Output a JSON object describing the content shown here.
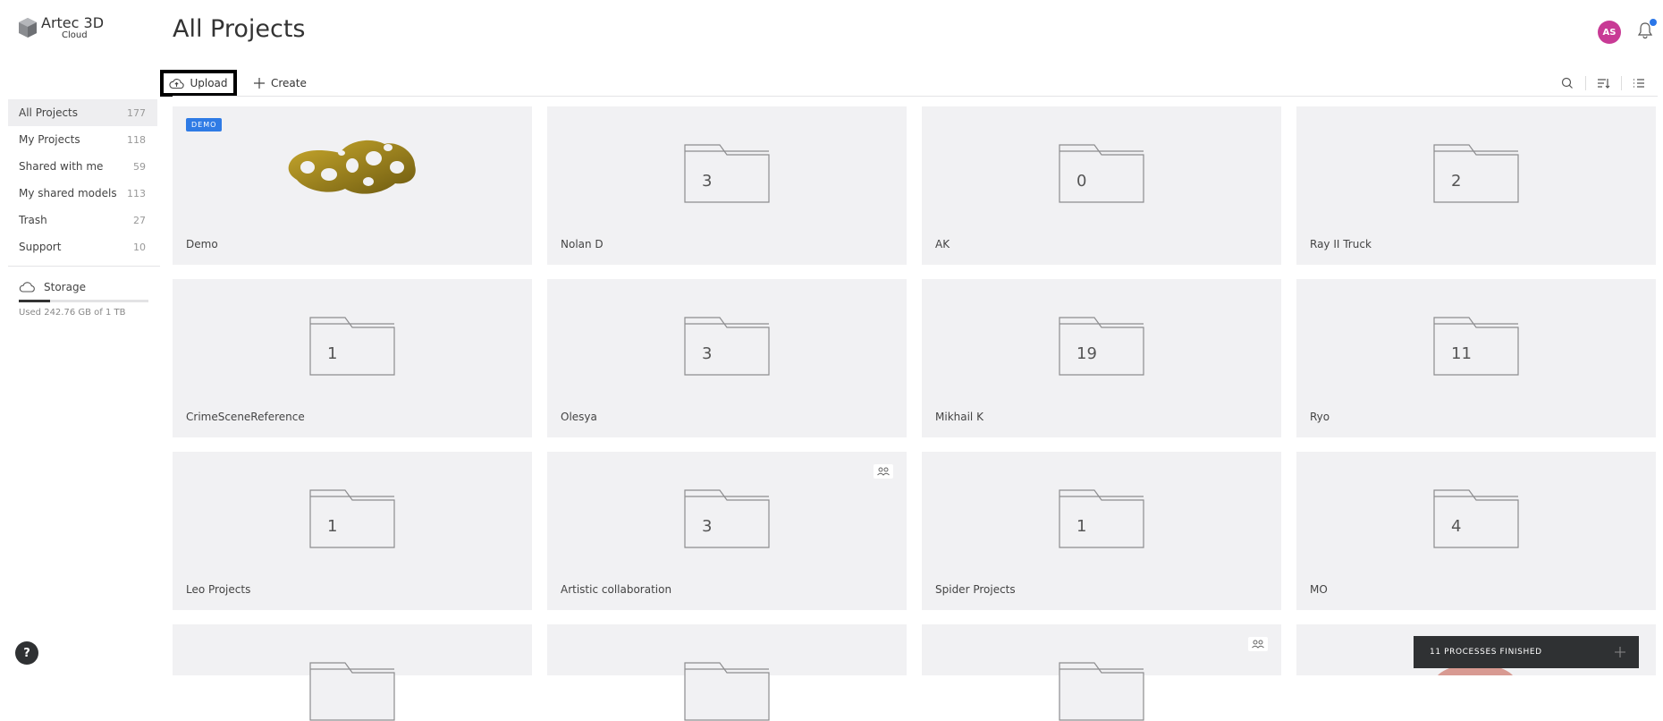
{
  "brand": {
    "name": "Artec 3D",
    "sub": "Cloud"
  },
  "page_title": "All Projects",
  "user": {
    "initials": "AS"
  },
  "toolbar": {
    "upload_label": "Upload",
    "create_label": "Create"
  },
  "sidebar": {
    "items": [
      {
        "label": "All Projects",
        "count": "177"
      },
      {
        "label": "My Projects",
        "count": "118"
      },
      {
        "label": "Shared with me",
        "count": "59"
      },
      {
        "label": "My shared models",
        "count": "113"
      },
      {
        "label": "Trash",
        "count": "27"
      },
      {
        "label": "Support",
        "count": "10"
      }
    ],
    "storage": {
      "label": "Storage",
      "used_text": "Used 242.76 GB of 1 TB",
      "used_fraction": 0.24
    }
  },
  "projects": [
    {
      "name": "Demo",
      "badge": "DEMO"
    },
    {
      "name": "Nolan D",
      "count": "3"
    },
    {
      "name": "AK",
      "count": "0"
    },
    {
      "name": "Ray II Truck",
      "count": "2"
    },
    {
      "name": "CrimeSceneReference",
      "count": "1"
    },
    {
      "name": "Olesya",
      "count": "3"
    },
    {
      "name": "Mikhail K",
      "count": "19"
    },
    {
      "name": "Ryo",
      "count": "11"
    },
    {
      "name": "Leo Projects",
      "count": "1"
    },
    {
      "name": "Artistic collaboration",
      "count": "3"
    },
    {
      "name": "Spider Projects",
      "count": "1"
    },
    {
      "name": "MO",
      "count": "4"
    }
  ],
  "help_label": "?",
  "toast": {
    "text": "11 PROCESSES FINISHED"
  }
}
